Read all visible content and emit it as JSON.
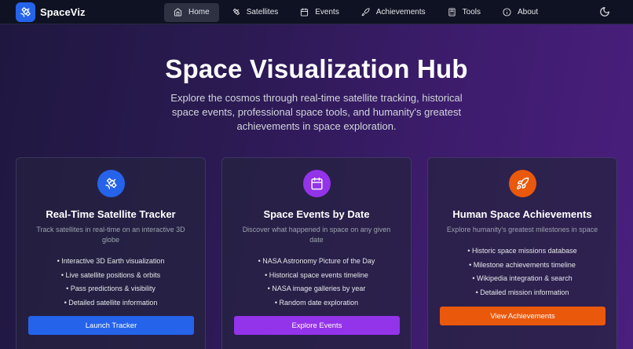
{
  "nav": {
    "brand": "SpaceViz",
    "items": [
      {
        "label": "Home",
        "icon": "home-icon"
      },
      {
        "label": "Satellites",
        "icon": "satellite-icon"
      },
      {
        "label": "Events",
        "icon": "calendar-icon"
      },
      {
        "label": "Achievements",
        "icon": "rocket-icon"
      },
      {
        "label": "Tools",
        "icon": "calculator-icon"
      },
      {
        "label": "About",
        "icon": "info-icon"
      }
    ],
    "active": "Home",
    "theme_icon": "moon-icon"
  },
  "hero": {
    "title": "Space Visualization Hub",
    "subtitle": "Explore the cosmos through real-time satellite tracking, historical space events, professional space tools, and humanity's greatest achievements in space exploration."
  },
  "cards": [
    {
      "title": "Real-Time Satellite Tracker",
      "desc": "Track satellites in real-time on an interactive 3D globe",
      "features": [
        "• Interactive 3D Earth visualization",
        "• Live satellite positions & orbits",
        "• Pass predictions & visibility",
        "• Detailed satellite information"
      ],
      "button": "Launch Tracker",
      "icon": "satellite-icon",
      "color": "#2563eb"
    },
    {
      "title": "Space Events by Date",
      "desc": "Discover what happened in space on any given date",
      "features": [
        "• NASA Astronomy Picture of the Day",
        "• Historical space events timeline",
        "• NASA image galleries by year",
        "• Random date exploration"
      ],
      "button": "Explore Events",
      "icon": "calendar-icon",
      "color": "#9333ea"
    },
    {
      "title": "Human Space Achievements",
      "desc": "Explore humanity's greatest milestones in space",
      "features": [
        "• Historic space missions database",
        "• Milestone achievements timeline",
        "• Wikipedia integration & search",
        "• Detailed mission information"
      ],
      "button": "View Achievements",
      "icon": "rocket-icon",
      "color": "#ea580c"
    }
  ]
}
